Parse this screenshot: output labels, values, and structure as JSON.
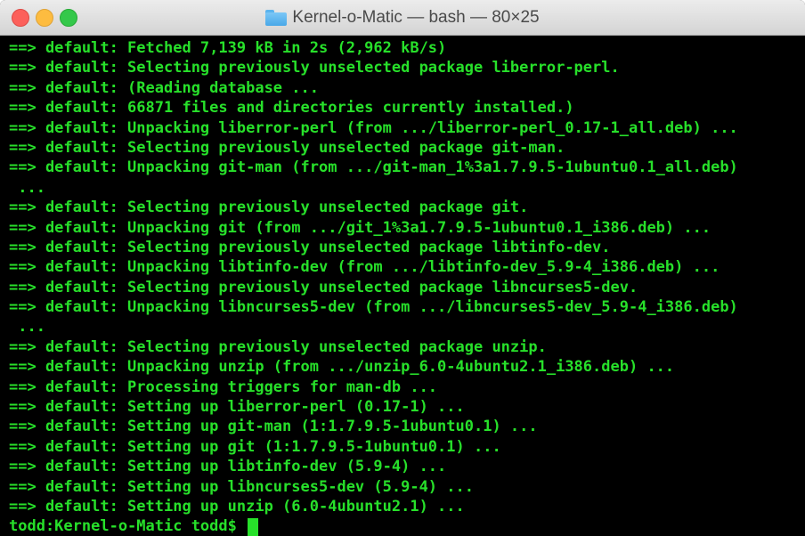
{
  "window": {
    "title": "Kernel-o-Matic — bash — 80×25",
    "folder_icon": "folder-icon",
    "controls": [
      "close-icon",
      "minimize-icon",
      "zoom-icon"
    ],
    "colors": {
      "background": "#000000",
      "text": "#27e02a",
      "close": "#fc605b",
      "minimize": "#fdbc40",
      "zoom": "#34c84a"
    }
  },
  "terminal": {
    "lines": [
      "==> default: Fetched 7,139 kB in 2s (2,962 kB/s)",
      "==> default: Selecting previously unselected package liberror-perl.",
      "==> default: (Reading database ...",
      "==> default: 66871 files and directories currently installed.)",
      "==> default: Unpacking liberror-perl (from .../liberror-perl_0.17-1_all.deb) ...",
      "==> default: Selecting previously unselected package git-man.",
      "==> default: Unpacking git-man (from .../git-man_1%3a1.7.9.5-1ubuntu0.1_all.deb)",
      " ...",
      "==> default: Selecting previously unselected package git.",
      "==> default: Unpacking git (from .../git_1%3a1.7.9.5-1ubuntu0.1_i386.deb) ...",
      "==> default: Selecting previously unselected package libtinfo-dev.",
      "==> default: Unpacking libtinfo-dev (from .../libtinfo-dev_5.9-4_i386.deb) ...",
      "==> default: Selecting previously unselected package libncurses5-dev.",
      "==> default: Unpacking libncurses5-dev (from .../libncurses5-dev_5.9-4_i386.deb)",
      " ...",
      "==> default: Selecting previously unselected package unzip.",
      "==> default: Unpacking unzip (from .../unzip_6.0-4ubuntu2.1_i386.deb) ...",
      "==> default: Processing triggers for man-db ...",
      "==> default: Setting up liberror-perl (0.17-1) ...",
      "==> default: Setting up git-man (1:1.7.9.5-1ubuntu0.1) ...",
      "==> default: Setting up git (1:1.7.9.5-1ubuntu0.1) ...",
      "==> default: Setting up libtinfo-dev (5.9-4) ...",
      "==> default: Setting up libncurses5-dev (5.9-4) ...",
      "==> default: Setting up unzip (6.0-4ubuntu2.1) ..."
    ],
    "prompt": "todd:Kernel-o-Matic todd$ "
  }
}
